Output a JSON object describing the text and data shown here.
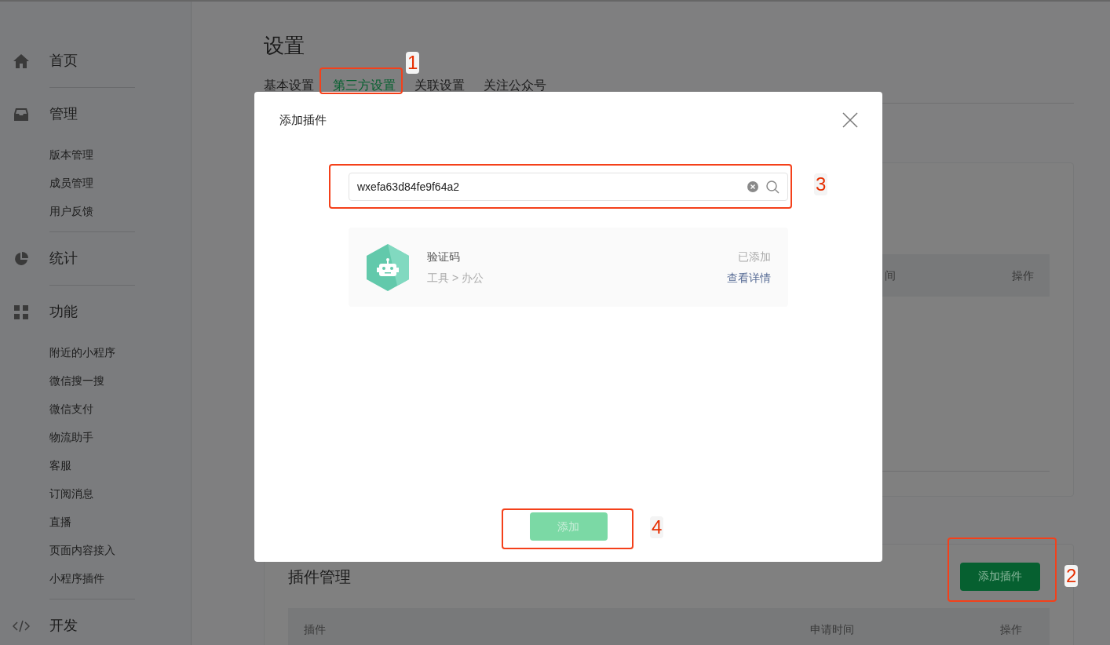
{
  "sidebar": {
    "sections": [
      {
        "label": "首页"
      },
      {
        "label": "管理",
        "children": [
          {
            "label": "版本管理"
          },
          {
            "label": "成员管理"
          },
          {
            "label": "用户反馈"
          }
        ]
      },
      {
        "label": "统计"
      },
      {
        "label": "功能",
        "children": [
          {
            "label": "附近的小程序"
          },
          {
            "label": "微信搜一搜"
          },
          {
            "label": "微信支付"
          },
          {
            "label": "物流助手"
          },
          {
            "label": "客服"
          },
          {
            "label": "订阅消息"
          },
          {
            "label": "直播"
          },
          {
            "label": "页面内容接入"
          },
          {
            "label": "小程序插件"
          }
        ]
      },
      {
        "label": "开发"
      }
    ]
  },
  "page": {
    "title": "设置",
    "tabs": [
      {
        "label": "基本设置",
        "selected": false
      },
      {
        "label": "第三方设置",
        "selected": true
      },
      {
        "label": "关联设置",
        "selected": false
      },
      {
        "label": "关注公众号",
        "selected": false
      }
    ],
    "service_card": {
      "columns": [
        "间",
        "操作"
      ]
    },
    "plugin_card": {
      "title": "插件管理",
      "button": "添加插件",
      "columns": [
        "插件",
        "申请时间",
        "操作"
      ]
    }
  },
  "modal": {
    "title": "添加插件",
    "search": {
      "value": "wxefa63d84fe9f64a2"
    },
    "result": {
      "name": "验证码",
      "category": "工具 > 办公",
      "status": "已添加",
      "link": "查看详情"
    },
    "add_button": {
      "label": "添加",
      "disabled": true
    }
  },
  "annotations": [
    {
      "label": "1"
    },
    {
      "label": "2"
    },
    {
      "label": "3"
    },
    {
      "label": "4"
    }
  ]
}
